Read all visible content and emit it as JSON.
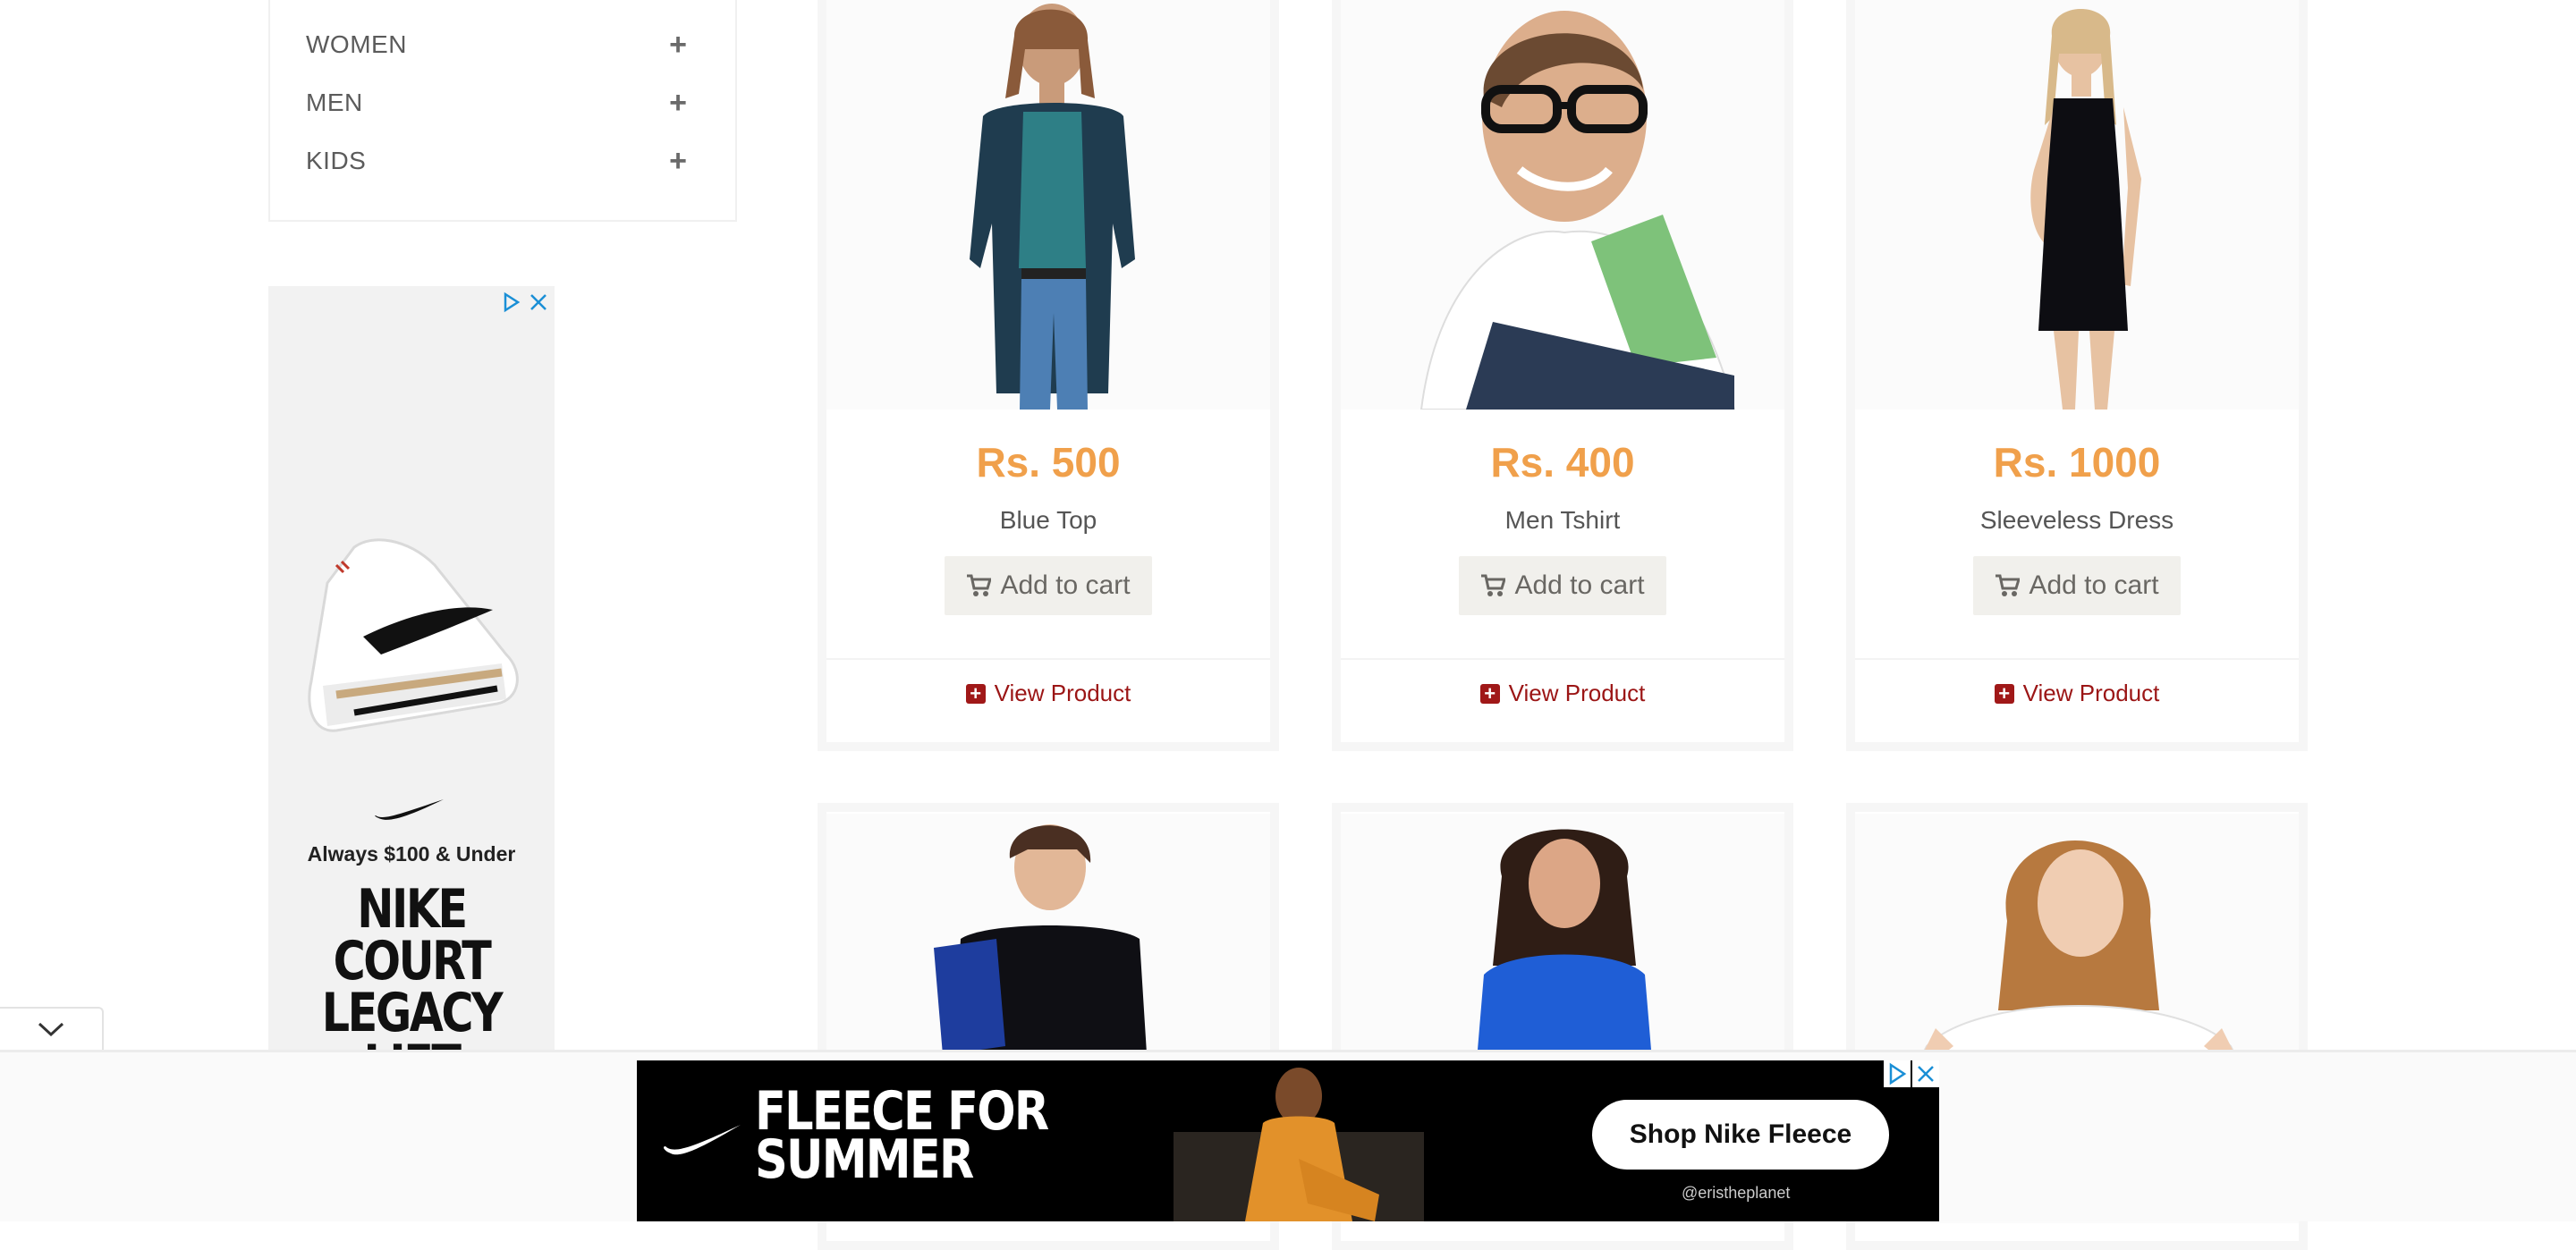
{
  "categories": [
    {
      "label": "WOMEN"
    },
    {
      "label": "MEN"
    },
    {
      "label": "KIDS"
    }
  ],
  "side_ad": {
    "tagline": "Always $100 & Under",
    "headline": "NIKE COURT LEGACY LIFT"
  },
  "products": [
    {
      "price": "Rs. 500",
      "name": "Blue Top"
    },
    {
      "price": "Rs. 400",
      "name": "Men Tshirt"
    },
    {
      "price": "Rs. 1000",
      "name": "Sleeveless Dress"
    }
  ],
  "card_actions": {
    "add_to_cart": "Add to cart",
    "view_product": "View Product"
  },
  "bottom_ad": {
    "headline_line1": "FLEECE FOR",
    "headline_line2": "SUMMER",
    "cta": "Shop Nike Fleece",
    "handle": "@eristheplanet"
  },
  "colors": {
    "price": "#f0a04b",
    "view_link": "#9b1515",
    "button_bg": "#f1f0ec"
  },
  "icons": [
    "plus-icon",
    "cart-icon",
    "plus-square-icon",
    "adchoices-icon",
    "close-icon",
    "chevron-down-icon",
    "nike-swoosh-icon"
  ]
}
